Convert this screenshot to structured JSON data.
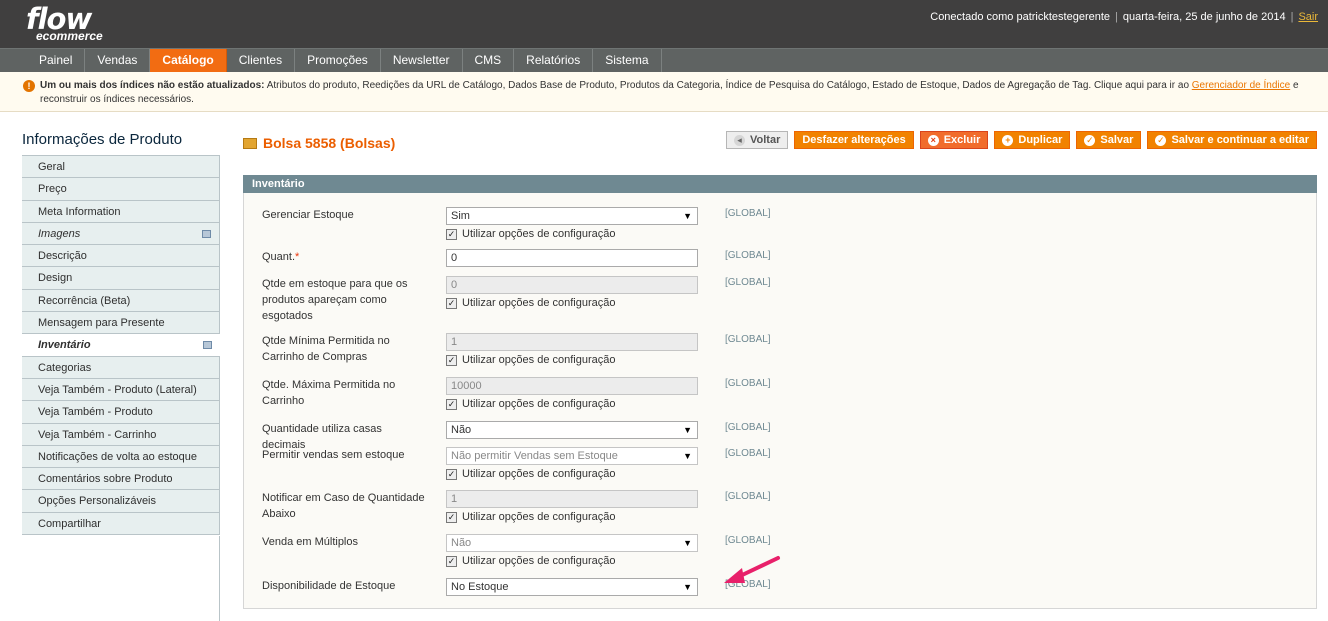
{
  "header": {
    "logo_main": "flow",
    "logo_sub": "ecommerce",
    "logged_in": "Conectado como patricktestegerente",
    "date": "quarta-feira, 25 de junho de 2014",
    "logout": "Sair"
  },
  "nav": [
    {
      "label": "Painel"
    },
    {
      "label": "Vendas"
    },
    {
      "label": "Catálogo",
      "active": true
    },
    {
      "label": "Clientes"
    },
    {
      "label": "Promoções"
    },
    {
      "label": "Newsletter"
    },
    {
      "label": "CMS"
    },
    {
      "label": "Relatórios"
    },
    {
      "label": "Sistema"
    }
  ],
  "notice": {
    "bold": "Um ou mais dos índices não estão atualizados:",
    "text": " Atributos do produto, Reedições da URL de Catálogo, Dados Base de Produto, Produtos da Categoria, Índice de Pesquisa do Catálogo, Estado de Estoque, Dados de Agregação de Tag. Clique aqui para ir ao ",
    "link": "Gerenciador de Índice",
    "tail": " e reconstruir os índices necessários."
  },
  "sidebar": {
    "title": "Informações de Produto",
    "tabs": [
      {
        "label": "Geral"
      },
      {
        "label": "Preço"
      },
      {
        "label": "Meta Information"
      },
      {
        "label": "Imagens",
        "italic": true,
        "mini": true
      },
      {
        "label": "Descrição"
      },
      {
        "label": "Design"
      },
      {
        "label": "Recorrência (Beta)"
      },
      {
        "label": "Mensagem para Presente"
      },
      {
        "label": "Inventário",
        "active": true,
        "mini": true
      },
      {
        "label": "Categorias"
      },
      {
        "label": "Veja Também - Produto (Lateral)"
      },
      {
        "label": "Veja Também - Produto"
      },
      {
        "label": "Veja Também - Carrinho"
      },
      {
        "label": "Notificações de volta ao estoque"
      },
      {
        "label": "Comentários sobre Produto"
      },
      {
        "label": "Opções Personalizáveis"
      },
      {
        "label": "Compartilhar"
      }
    ]
  },
  "main": {
    "title": "Bolsa 5858 (Bolsas)",
    "buttons": {
      "back": "Voltar",
      "reset": "Desfazer alterações",
      "delete": "Excluir",
      "duplicate": "Duplicar",
      "save": "Salvar",
      "save_continue": "Salvar e continuar a editar"
    },
    "section_title": "Inventário",
    "use_config": "Utilizar opções de configuração",
    "scope": "[GLOBAL]",
    "fields": [
      {
        "label": "Gerenciar Estoque",
        "value": "Sim",
        "type": "select",
        "disabled": false,
        "checkbox": true
      },
      {
        "label": "Quant.",
        "required": "*",
        "value": "0",
        "type": "input",
        "disabled": false,
        "checkbox": false
      },
      {
        "label": "Qtde em estoque para que os produtos apareçam como esgotados",
        "value": "0",
        "type": "input",
        "disabled": true,
        "checkbox": true
      },
      {
        "label": "Qtde Mínima Permitida no Carrinho de Compras",
        "value": "1",
        "type": "input",
        "disabled": true,
        "checkbox": true
      },
      {
        "label": "Qtde. Máxima Permitida no Carrinho",
        "value": "10000",
        "type": "input",
        "disabled": true,
        "checkbox": true
      },
      {
        "label": "Quantidade utiliza casas decimais",
        "value": "Não",
        "type": "select",
        "disabled": false,
        "checkbox": false
      },
      {
        "label": "Permitir vendas sem estoque",
        "value": "Não permitir Vendas sem Estoque",
        "type": "select",
        "disabled": true,
        "checkbox": true
      },
      {
        "label": "Notificar em Caso de Quantidade Abaixo",
        "value": "1",
        "type": "input",
        "disabled": true,
        "checkbox": true
      },
      {
        "label": "Venda em Múltiplos",
        "value": "Não",
        "type": "select",
        "disabled": true,
        "checkbox": true
      },
      {
        "label": "Disponibilidade de Estoque",
        "value": "No Estoque",
        "type": "select",
        "disabled": false,
        "checkbox": false
      }
    ]
  },
  "colors": {
    "header_bg": "#403f3f",
    "nav_bg": "#5f6362",
    "nav_active": "#f26c12",
    "accent": "#f18200",
    "section_head": "#6f8992",
    "arrow": "#e8206a"
  }
}
